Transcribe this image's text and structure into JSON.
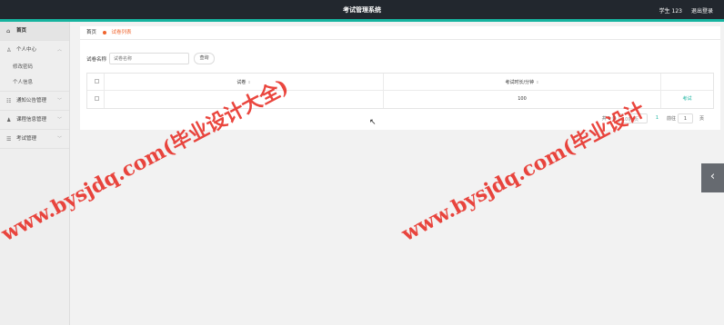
{
  "header": {
    "title": "考试管理系统",
    "user": "学生 123",
    "logout": "退出登录"
  },
  "sidebar": {
    "home": "首页",
    "personal": "个人中心",
    "change_password": "修改密码",
    "personal_info": "个人信息",
    "notice_mgmt": "通知公告管理",
    "course_mgmt": "课程信息管理",
    "exam_mgmt": "考试管理"
  },
  "breadcrumb": {
    "home": "首页",
    "current": "试卷列表"
  },
  "search": {
    "label": "试卷名称",
    "placeholder": "试卷名称",
    "button": "查询"
  },
  "table": {
    "headers": [
      "试卷",
      "考试时长/分钟",
      ""
    ],
    "rows": [
      {
        "name": "",
        "duration": "100",
        "action": "考试"
      }
    ]
  },
  "pagination": {
    "total": "共 1 条",
    "page_size": "10条/页",
    "current_page": "1",
    "goto": "前往",
    "goto_value": "1",
    "page_unit": "页"
  },
  "watermark": {
    "line1": "www.bysjdq.com(毕业设计大全)",
    "line2": "www.bysjdq.com(毕业设计"
  },
  "side_tab_icon": "chevron-left-icon"
}
